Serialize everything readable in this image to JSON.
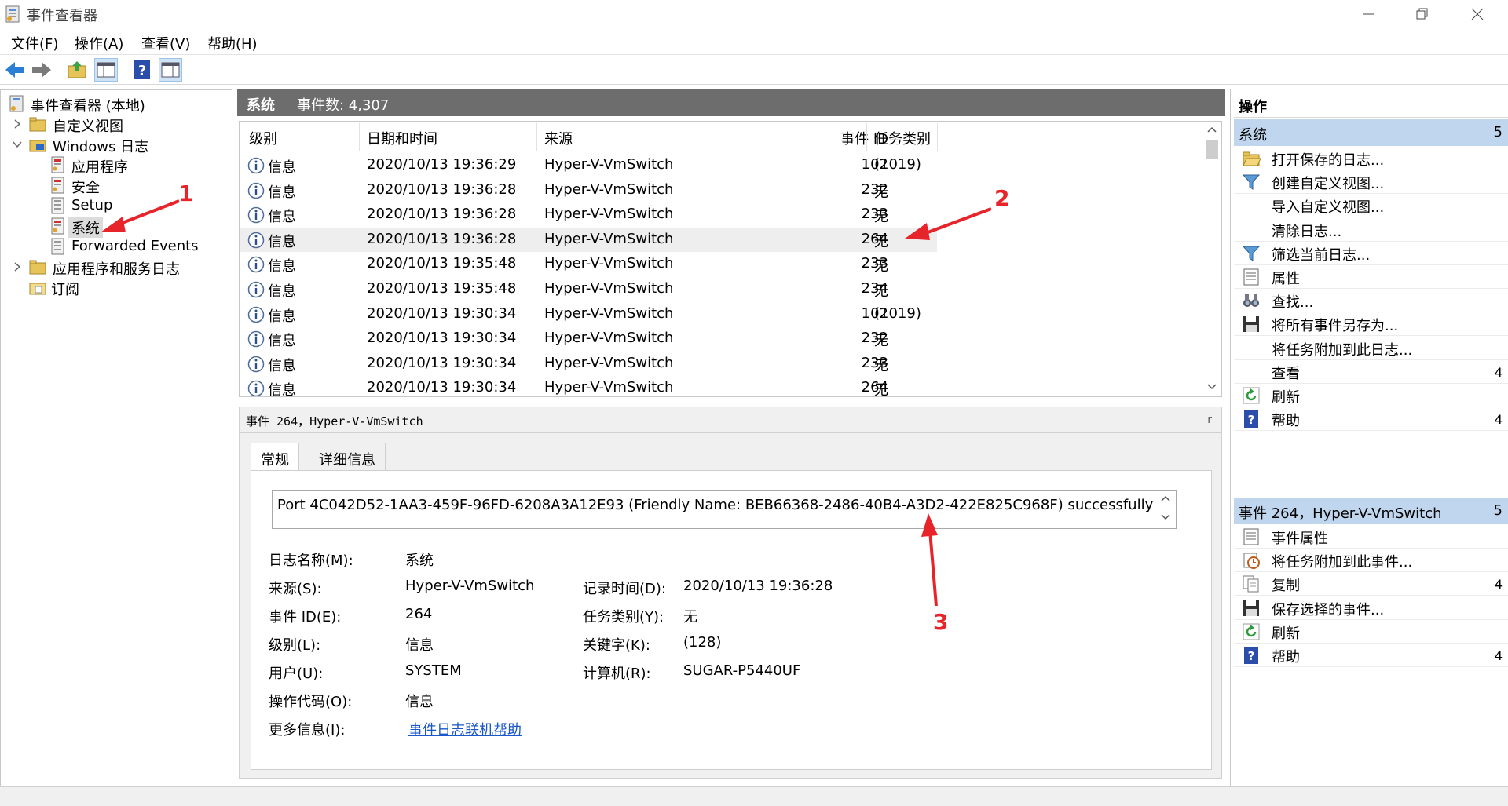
{
  "window": {
    "title": "事件查看器"
  },
  "menu": [
    {
      "label": "文件(F)"
    },
    {
      "label": "操作(A)"
    },
    {
      "label": "查看(V)"
    },
    {
      "label": "帮助(H)"
    }
  ],
  "tree": {
    "root": "事件查看器 (本地)",
    "custom_views": "自定义视图",
    "windows_logs": "Windows 日志",
    "application": "应用程序",
    "security": "安全",
    "setup": "Setup",
    "system": "系统",
    "forwarded": "Forwarded Events",
    "app_service_logs": "应用程序和服务日志",
    "subscriptions": "订阅"
  },
  "center": {
    "title": "系统",
    "count": "事件数: 4,307"
  },
  "columns": {
    "level": "级别",
    "datetime": "日期和时间",
    "source": "来源",
    "event_id": "事件 ID",
    "task": "任务类别"
  },
  "rows": [
    {
      "level": "信息",
      "datetime": "2020/10/13 19:36:29",
      "source": "Hyper-V-VmSwitch",
      "event_id": "102",
      "task": "(1019)"
    },
    {
      "level": "信息",
      "datetime": "2020/10/13 19:36:28",
      "source": "Hyper-V-VmSwitch",
      "event_id": "232",
      "task": "无"
    },
    {
      "level": "信息",
      "datetime": "2020/10/13 19:36:28",
      "source": "Hyper-V-VmSwitch",
      "event_id": "233",
      "task": "无"
    },
    {
      "level": "信息",
      "datetime": "2020/10/13 19:36:28",
      "source": "Hyper-V-VmSwitch",
      "event_id": "264",
      "task": "无"
    },
    {
      "level": "信息",
      "datetime": "2020/10/13 19:35:48",
      "source": "Hyper-V-VmSwitch",
      "event_id": "233",
      "task": "无"
    },
    {
      "level": "信息",
      "datetime": "2020/10/13 19:35:48",
      "source": "Hyper-V-VmSwitch",
      "event_id": "234",
      "task": "无"
    },
    {
      "level": "信息",
      "datetime": "2020/10/13 19:30:34",
      "source": "Hyper-V-VmSwitch",
      "event_id": "102",
      "task": "(1019)"
    },
    {
      "level": "信息",
      "datetime": "2020/10/13 19:30:34",
      "source": "Hyper-V-VmSwitch",
      "event_id": "232",
      "task": "无"
    },
    {
      "level": "信息",
      "datetime": "2020/10/13 19:30:34",
      "source": "Hyper-V-VmSwitch",
      "event_id": "233",
      "task": "无"
    },
    {
      "level": "信息",
      "datetime": "2020/10/13 19:30:34",
      "source": "Hyper-V-VmSwitch",
      "event_id": "264",
      "task": "无"
    }
  ],
  "detail": {
    "title": "事件 264，Hyper-V-VmSwitch",
    "close": "r",
    "tabs": [
      "常规",
      "详细信息"
    ],
    "description": "Port 4C042D52-1AA3-459F-96FD-6208A3A12E93 (Friendly Name: BEB66368-2486-40B4-A3D2-422E825C968F) successfully",
    "fields": {
      "log_name_label": "日志名称(M):",
      "log_name": "系统",
      "source_label": "来源(S):",
      "source": "Hyper-V-VmSwitch",
      "logged_label": "记录时间(D):",
      "logged": "2020/10/13 19:36:28",
      "event_id_label": "事件 ID(E):",
      "event_id": "264",
      "task_label": "任务类别(Y):",
      "task": "无",
      "level_label": "级别(L):",
      "level": "信息",
      "keywords_label": "关键字(K):",
      "keywords": "(128)",
      "user_label": "用户(U):",
      "user": "SYSTEM",
      "computer_label": "计算机(R):",
      "computer": "SUGAR-P5440UF",
      "opcode_label": "操作代码(O):",
      "opcode": "信息",
      "more_info_label": "更多信息(I):",
      "more_info_link": "事件日志联机帮助"
    }
  },
  "actions": {
    "header": "操作",
    "system_section": {
      "title": "系统",
      "badge": "5"
    },
    "system_items": [
      {
        "label": "打开保存的日志...",
        "icon": "folder-open-icon"
      },
      {
        "label": "创建自定义视图...",
        "icon": "filter-icon"
      },
      {
        "label": "导入自定义视图...",
        "icon": ""
      },
      {
        "label": "清除日志...",
        "icon": ""
      },
      {
        "label": "筛选当前日志...",
        "icon": "filter-icon"
      },
      {
        "label": "属性",
        "icon": "properties-icon"
      },
      {
        "label": "查找...",
        "icon": "binoculars-icon"
      },
      {
        "label": "将所有事件另存为...",
        "icon": "save-icon"
      },
      {
        "label": "将任务附加到此日志...",
        "icon": ""
      },
      {
        "label": "查看",
        "icon": "",
        "badge": "4"
      },
      {
        "label": "刷新",
        "icon": "refresh-icon"
      },
      {
        "label": "帮助",
        "icon": "help-icon",
        "badge": "4"
      }
    ],
    "event_section": {
      "title": "事件 264，Hyper-V-VmSwitch",
      "badge": "5"
    },
    "event_items": [
      {
        "label": "事件属性",
        "icon": "properties-icon"
      },
      {
        "label": "将任务附加到此事件...",
        "icon": "task-clock-icon"
      },
      {
        "label": "复制",
        "icon": "copy-icon",
        "badge": "4"
      },
      {
        "label": "保存选择的事件...",
        "icon": "save-icon"
      },
      {
        "label": "刷新",
        "icon": "refresh-icon"
      },
      {
        "label": "帮助",
        "icon": "help-icon",
        "badge": "4"
      }
    ]
  },
  "annotations": [
    "1",
    "2",
    "3"
  ],
  "colors": {
    "accent": "#bfd6ee",
    "header_gray": "#6d6d6d",
    "annotation_red": "#e8242b",
    "link": "#1a57c9"
  }
}
